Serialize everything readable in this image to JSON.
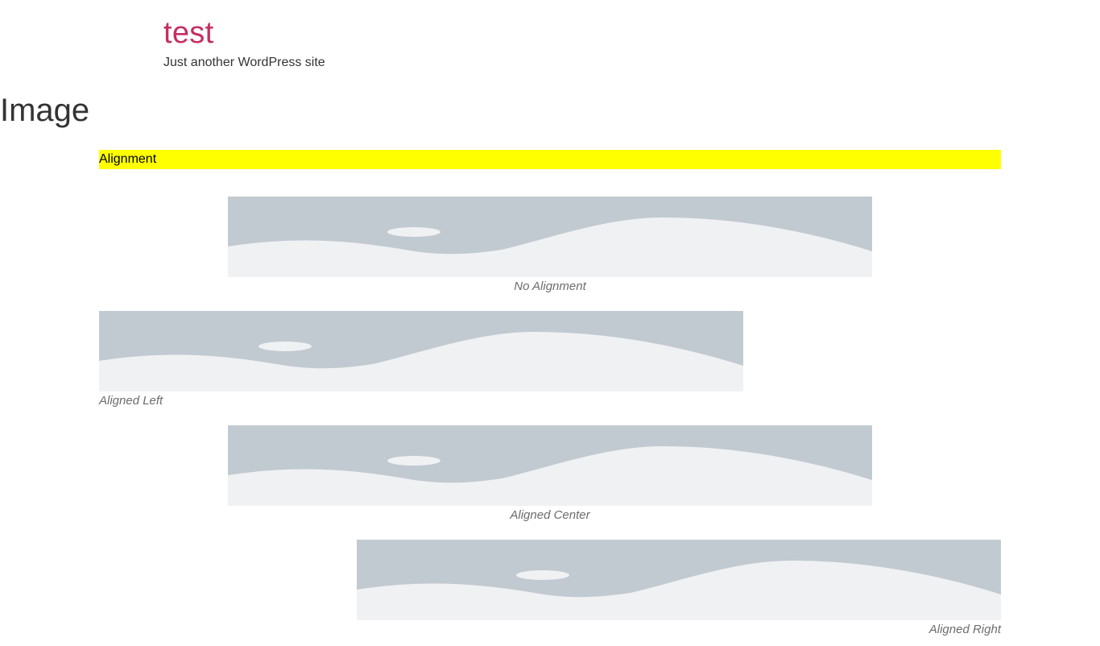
{
  "site": {
    "title": "test",
    "tagline": "Just another WordPress site"
  },
  "page": {
    "heading": "Image"
  },
  "section": {
    "heading": "Alignment"
  },
  "figures": [
    {
      "caption": "No Alignment",
      "alignment": "none",
      "icon": "image-placeholder-icon"
    },
    {
      "caption": "Aligned Left",
      "alignment": "left",
      "icon": "image-placeholder-icon"
    },
    {
      "caption": "Aligned Center",
      "alignment": "center",
      "icon": "image-placeholder-icon"
    },
    {
      "caption": "Aligned Right",
      "alignment": "right",
      "icon": "image-placeholder-icon"
    }
  ],
  "colors": {
    "site_title": "#c62d62",
    "highlight": "#ffff00",
    "placeholder_sky": "#c2cad1",
    "placeholder_ground": "#f0f1f3",
    "caption": "#6c6c6c"
  }
}
